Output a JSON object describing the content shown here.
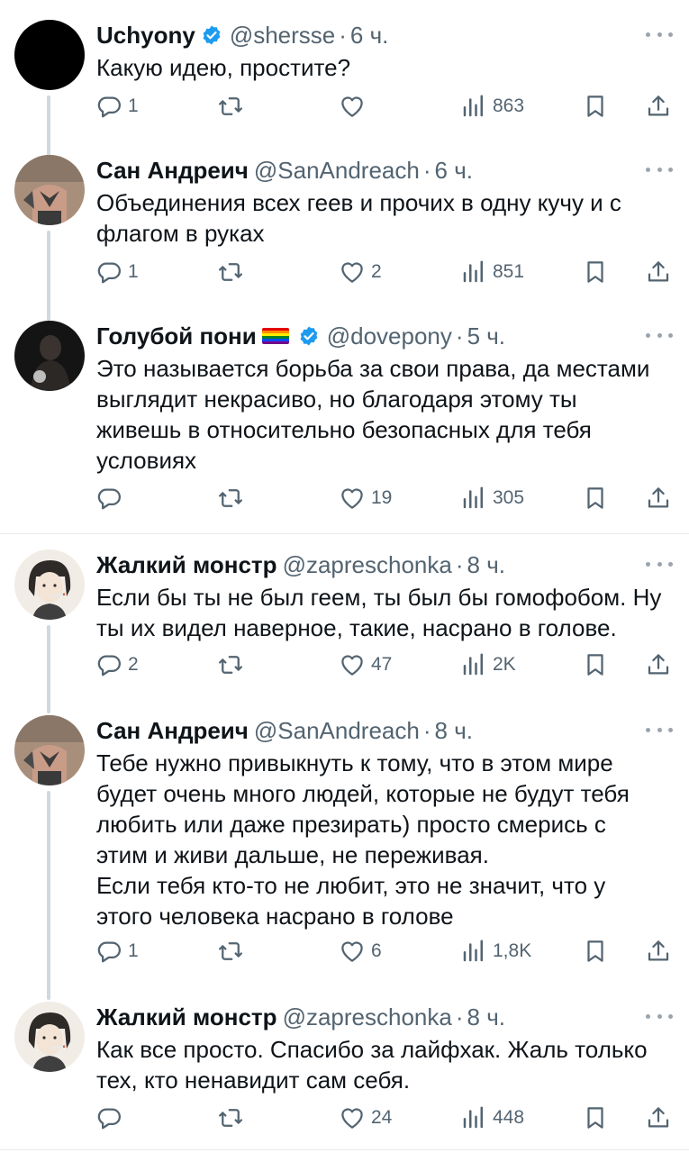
{
  "tweets": [
    {
      "name": "Uchyony",
      "verified": true,
      "flag": false,
      "handle": "@shersse",
      "time": "6 ч.",
      "lines": [
        "Какую идею, простите?"
      ],
      "reply_count": "1",
      "retweet_count": "",
      "like_count": "",
      "views": "863"
    },
    {
      "name": "Сан Андреич",
      "verified": false,
      "flag": false,
      "handle": "@SanAndreach",
      "time": "6 ч.",
      "lines": [
        "Объединения всех геев и прочих в одну кучу и с",
        "флагом в руках"
      ],
      "reply_count": "1",
      "retweet_count": "",
      "like_count": "2",
      "views": "851"
    },
    {
      "name": "Голубой пони",
      "verified": true,
      "flag": true,
      "handle": "@dovepony",
      "time": "5 ч.",
      "lines": [
        "Это называется борьба за свои права, да местами",
        "выглядит некрасиво, но благодаря этому ты",
        "живешь в относительно безопасных для тебя",
        "условиях"
      ],
      "reply_count": "",
      "retweet_count": "",
      "like_count": "19",
      "views": "305"
    },
    {
      "name": "Жалкий монстр",
      "verified": false,
      "flag": false,
      "handle": "@zapreschonka",
      "time": "8 ч.",
      "lines": [
        "Если бы ты не был геем, ты был бы гомофобом. Ну",
        "ты их видел наверное, такие, насрано в голове."
      ],
      "reply_count": "2",
      "retweet_count": "",
      "like_count": "47",
      "views": "2K"
    },
    {
      "name": "Сан Андреич",
      "verified": false,
      "flag": false,
      "handle": "@SanAndreach",
      "time": "8 ч.",
      "lines": [
        "Тебе нужно привыкнуть к тому, что в этом мире",
        "будет очень много людей, которые не будут тебя",
        "любить или даже презирать) просто смерись с",
        "этим и живи дальше, не переживая.",
        "Если тебя кто-то не любит, это не значит, что у",
        "этого человека насрано в голове"
      ],
      "reply_count": "1",
      "retweet_count": "",
      "like_count": "6",
      "views": "1,8K"
    },
    {
      "name": "Жалкий монстр",
      "verified": false,
      "flag": false,
      "handle": "@zapreschonka",
      "time": "8 ч.",
      "lines": [
        "Как все просто. Спасибо за лайфхак. Жаль только",
        "тех, кто ненавидит сам себя."
      ],
      "reply_count": "",
      "retweet_count": "",
      "like_count": "24",
      "views": "448"
    }
  ],
  "colors": {
    "text": "#0f1419",
    "secondary": "#536471",
    "verified": "#1d9bf0",
    "thread_line": "#cfd9de",
    "divider": "#e6ecf0"
  },
  "icons": {
    "reply": "speech-bubble-icon",
    "retweet": "repost-arrows-icon",
    "like": "heart-icon",
    "views": "bar-chart-icon",
    "bookmark": "bookmark-icon",
    "share": "upload-icon",
    "verified": "verified-badge-icon",
    "more": "ellipsis-icon"
  }
}
